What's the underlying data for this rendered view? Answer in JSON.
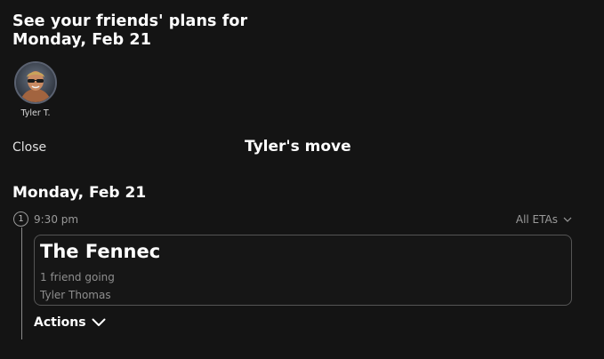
{
  "header": {
    "title_line1": "See your friends' plans for",
    "title_line2": "Monday, Feb 21"
  },
  "friends": [
    {
      "name": "Tyler T."
    }
  ],
  "panel": {
    "close_label": "Close",
    "title": "Tyler's move"
  },
  "day": {
    "heading": "Monday, Feb 21",
    "stops": [
      {
        "number": "1",
        "time": "9:30 pm",
        "eta_label": "All ETAs",
        "venue": "The Fennec",
        "going": "1 friend going",
        "attendees": "Tyler Thomas"
      }
    ],
    "actions_label": "Actions"
  },
  "icons": {
    "eta_toggle": "chevron-down-icon",
    "actions_toggle": "chevron-down-icon"
  }
}
